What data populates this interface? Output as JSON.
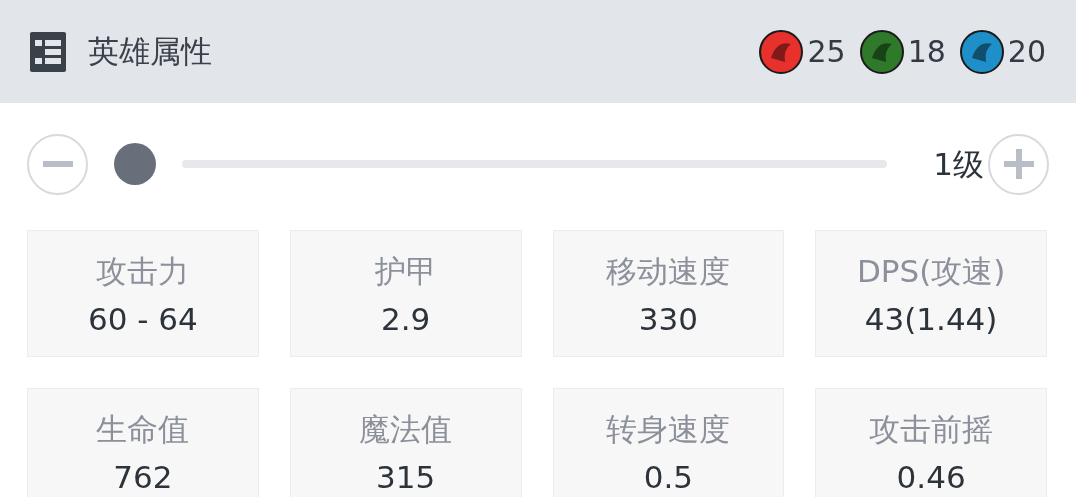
{
  "header": {
    "title": "英雄属性",
    "attributes": [
      {
        "value": "25",
        "color": "#e8302c"
      },
      {
        "value": "18",
        "color": "#2f7a2a"
      },
      {
        "value": "20",
        "color": "#1e8fc8"
      }
    ]
  },
  "level_slider": {
    "reading": "1级"
  },
  "stats": [
    {
      "label": "攻击力",
      "value": "60 - 64"
    },
    {
      "label": "护甲",
      "value": "2.9"
    },
    {
      "label": "移动速度",
      "value": "330"
    },
    {
      "label": "DPS(攻速)",
      "value": "43(1.44)"
    },
    {
      "label": "生命值",
      "value": "762"
    },
    {
      "label": "魔法值",
      "value": "315"
    },
    {
      "label": "转身速度",
      "value": "0.5"
    },
    {
      "label": "攻击前摇",
      "value": "0.46"
    }
  ]
}
